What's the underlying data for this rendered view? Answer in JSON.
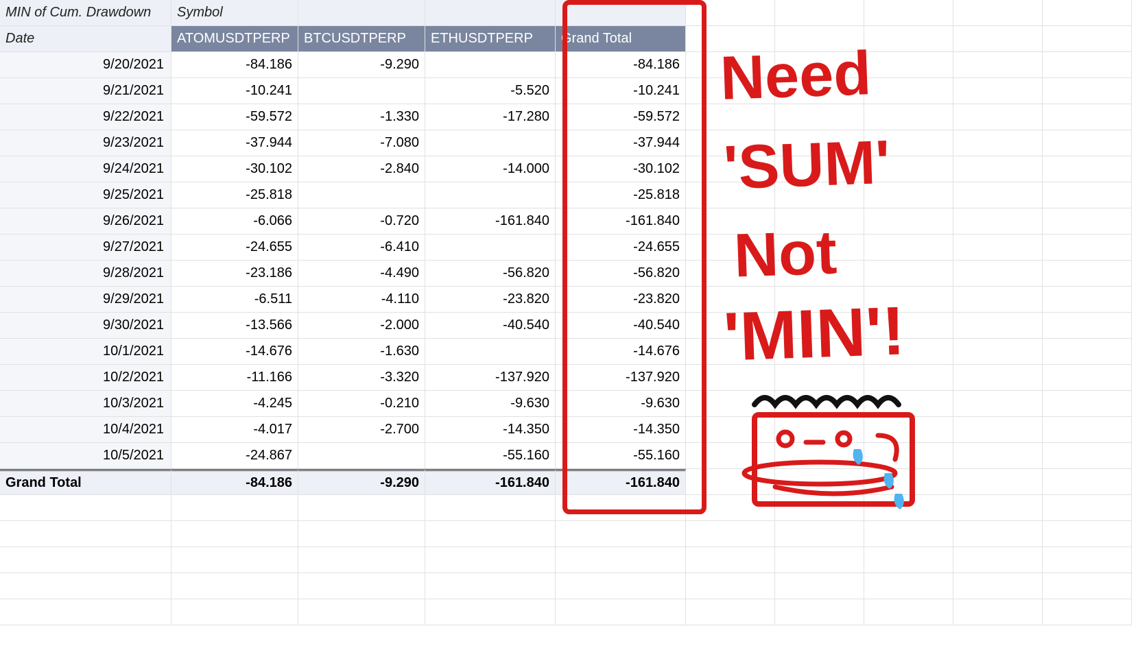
{
  "pivot": {
    "title": "MIN of Cum. Drawdown",
    "col_group_label": "Symbol",
    "row_label": "Date",
    "columns": [
      "ATOMUSDTPERP",
      "BTCUSDTPERP",
      "ETHUSDTPERP",
      "Grand Total"
    ],
    "rows": [
      {
        "date": "9/20/2021",
        "vals": [
          "-84.186",
          "-9.290",
          "",
          "-84.186"
        ]
      },
      {
        "date": "9/21/2021",
        "vals": [
          "-10.241",
          "",
          "-5.520",
          "-10.241"
        ]
      },
      {
        "date": "9/22/2021",
        "vals": [
          "-59.572",
          "-1.330",
          "-17.280",
          "-59.572"
        ]
      },
      {
        "date": "9/23/2021",
        "vals": [
          "-37.944",
          "-7.080",
          "",
          "-37.944"
        ]
      },
      {
        "date": "9/24/2021",
        "vals": [
          "-30.102",
          "-2.840",
          "-14.000",
          "-30.102"
        ]
      },
      {
        "date": "9/25/2021",
        "vals": [
          "-25.818",
          "",
          "",
          "-25.818"
        ]
      },
      {
        "date": "9/26/2021",
        "vals": [
          "-6.066",
          "-0.720",
          "-161.840",
          "-161.840"
        ]
      },
      {
        "date": "9/27/2021",
        "vals": [
          "-24.655",
          "-6.410",
          "",
          "-24.655"
        ]
      },
      {
        "date": "9/28/2021",
        "vals": [
          "-23.186",
          "-4.490",
          "-56.820",
          "-56.820"
        ]
      },
      {
        "date": "9/29/2021",
        "vals": [
          "-6.511",
          "-4.110",
          "-23.820",
          "-23.820"
        ]
      },
      {
        "date": "9/30/2021",
        "vals": [
          "-13.566",
          "-2.000",
          "-40.540",
          "-40.540"
        ]
      },
      {
        "date": "10/1/2021",
        "vals": [
          "-14.676",
          "-1.630",
          "",
          "-14.676"
        ]
      },
      {
        "date": "10/2/2021",
        "vals": [
          "-11.166",
          "-3.320",
          "-137.920",
          "-137.920"
        ]
      },
      {
        "date": "10/3/2021",
        "vals": [
          "-4.245",
          "-0.210",
          "-9.630",
          "-9.630"
        ]
      },
      {
        "date": "10/4/2021",
        "vals": [
          "-4.017",
          "-2.700",
          "-14.350",
          "-14.350"
        ]
      },
      {
        "date": "10/5/2021",
        "vals": [
          "-24.867",
          "",
          "-55.160",
          "-55.160"
        ]
      }
    ],
    "grand_total_label": "Grand Total",
    "grand_total": [
      "-84.186",
      "-9.290",
      "-161.840",
      "-161.840"
    ]
  },
  "annotation": {
    "lines": [
      "Need",
      "'SUM'",
      "Not",
      "'MIN'!"
    ],
    "face_icon": "crying-face",
    "color": "#d91a1a"
  }
}
